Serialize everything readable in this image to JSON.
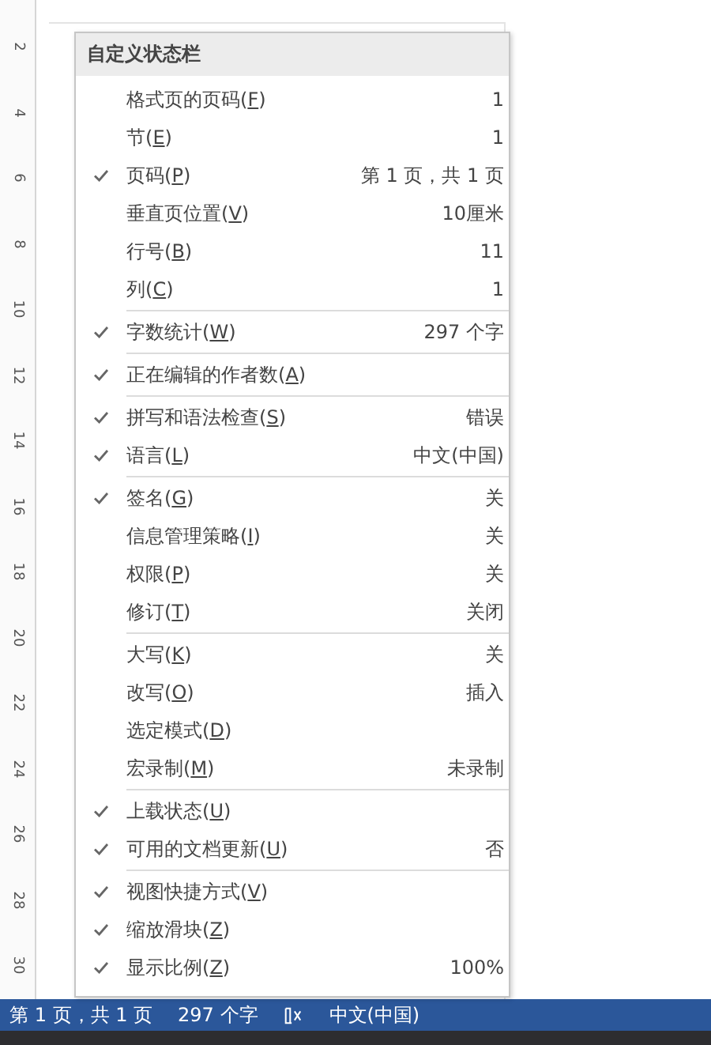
{
  "ruler": {
    "labels": [
      "2",
      "4",
      "6",
      "8",
      "10",
      "12",
      "14",
      "16",
      "18",
      "20",
      "22",
      "24",
      "26",
      "28",
      "30"
    ]
  },
  "menu": {
    "title": "自定义状态栏",
    "groups": [
      [
        {
          "label": "格式页的页码(F)",
          "value": "1",
          "checked": false
        },
        {
          "label": "节(E)",
          "value": "1",
          "checked": false
        },
        {
          "label": "页码(P)",
          "value": "第 1 页，共 1 页",
          "checked": true
        },
        {
          "label": "垂直页位置(V)",
          "value": "10厘米",
          "checked": false
        },
        {
          "label": "行号(B)",
          "value": "11",
          "checked": false
        },
        {
          "label": "列(C)",
          "value": "1",
          "checked": false
        }
      ],
      [
        {
          "label": "字数统计(W)",
          "value": "297 个字",
          "checked": true
        }
      ],
      [
        {
          "label": "正在编辑的作者数(A)",
          "checked": true
        }
      ],
      [
        {
          "label": "拼写和语法检查(S)",
          "value": "错误",
          "checked": true
        },
        {
          "label": "语言(L)",
          "value": "中文(中国)",
          "checked": true
        }
      ],
      [
        {
          "label": "签名(G)",
          "value": "关",
          "checked": true
        },
        {
          "label": "信息管理策略(I)",
          "value": "关",
          "checked": false
        },
        {
          "label": "权限(P)",
          "value": "关",
          "checked": false
        },
        {
          "label": "修订(T)",
          "value": "关闭",
          "checked": false
        }
      ],
      [
        {
          "label": "大写(K)",
          "value": "关",
          "checked": false
        },
        {
          "label": "改写(O)",
          "value": "插入",
          "checked": false
        },
        {
          "label": "选定模式(D)",
          "checked": false
        },
        {
          "label": "宏录制(M)",
          "value": "未录制",
          "checked": false
        }
      ],
      [
        {
          "label": "上载状态(U)",
          "checked": true
        },
        {
          "label": "可用的文档更新(U)",
          "value": "否",
          "checked": true
        }
      ],
      [
        {
          "label": "视图快捷方式(V)",
          "checked": true
        },
        {
          "label": "缩放滑块(Z)",
          "checked": true
        },
        {
          "label": "显示比例(Z)",
          "value": "100%",
          "checked": true
        }
      ]
    ]
  },
  "status_bar": {
    "page": "第 1 页，共 1 页",
    "words": "297 个字",
    "language": "中文(中国)"
  }
}
